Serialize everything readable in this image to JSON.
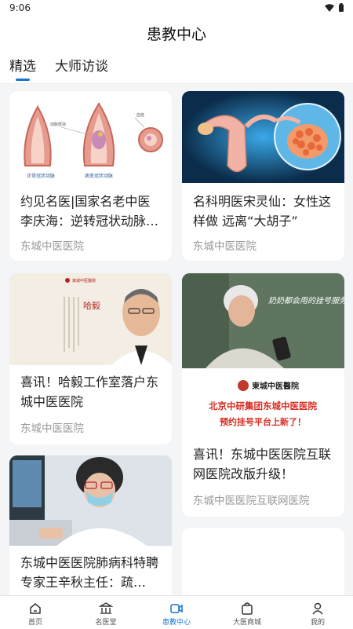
{
  "status": {
    "time": "9:06"
  },
  "header": {
    "title": "患教中心"
  },
  "tabs": [
    {
      "label": "精选",
      "active": true
    },
    {
      "label": "大师访谈",
      "active": false
    }
  ],
  "cards": [
    {
      "title": "约见名医|国家名老中医李庆海：逆转冠状动脉…",
      "source": "东城中医医院",
      "image": {
        "labels": [
          "正常冠状动脉",
          "病变冠状动脉",
          "动脉斑块",
          "血栓"
        ]
      }
    },
    {
      "title": "名科明医宋灵仙：女性这样做 远离“大胡子”",
      "source": "东城中医医院"
    },
    {
      "title": "喜讯！哈毅工作室落户东城中医医院",
      "source": "东城中医医院",
      "image": {
        "logo": "東城中医醫院",
        "name_text": "哈毅"
      }
    },
    {
      "title": "喜讯！东城中医医院互联网医院改版升级！",
      "source": "东城中医医院互联网医院",
      "image": {
        "overlay": "奶奶都会用的挂号服务",
        "logo": "東城中医醫院",
        "headline": "北京中研集团东城中医医院",
        "subline": "预约挂号平台上新了！"
      }
    },
    {
      "title": "东城中医医院肺病科特聘专家王辛秋主任：疏…",
      "source": ""
    }
  ],
  "nav": [
    {
      "label": "首页",
      "icon": "home-icon",
      "active": false
    },
    {
      "label": "名医堂",
      "icon": "hall-icon",
      "active": false
    },
    {
      "label": "患教中心",
      "icon": "video-icon",
      "active": true
    },
    {
      "label": "大医商城",
      "icon": "shopping-bag-icon",
      "active": false
    },
    {
      "label": "我的",
      "icon": "user-icon",
      "active": false
    }
  ],
  "colors": {
    "accent": "#1976d2",
    "background": "#f4f5f7",
    "muted": "#999999"
  }
}
